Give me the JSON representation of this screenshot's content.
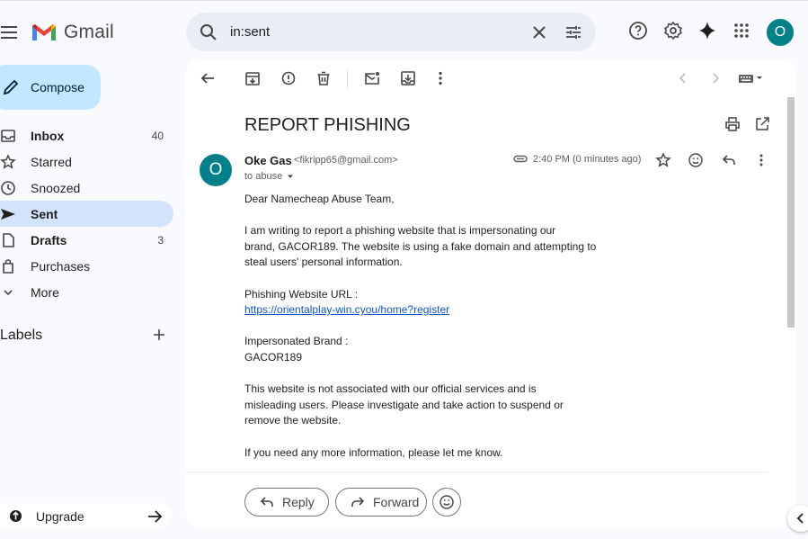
{
  "app": {
    "logo_text": "Gmail",
    "account_initial": "O"
  },
  "search": {
    "value": "in:sent"
  },
  "sidebar": {
    "compose_label": "Compose",
    "items": [
      {
        "label": "Inbox",
        "count": "40",
        "icon": "inbox-icon"
      },
      {
        "label": "Starred",
        "count": "",
        "icon": "star-icon"
      },
      {
        "label": "Snoozed",
        "count": "",
        "icon": "clock-icon"
      },
      {
        "label": "Sent",
        "count": "",
        "icon": "send-icon"
      },
      {
        "label": "Drafts",
        "count": "3",
        "icon": "draft-icon"
      },
      {
        "label": "Purchases",
        "count": "",
        "icon": "shopping-bag-icon"
      },
      {
        "label": "More",
        "count": "",
        "icon": "chevron-down-icon"
      }
    ],
    "labels_title": "Labels",
    "upgrade_label": "Upgrade"
  },
  "email": {
    "subject": "REPORT PHISHING",
    "sender_initial": "O",
    "sender_name": "Oke Gas",
    "sender_email": "<fikripp65@gmail.com>",
    "to": "to abuse",
    "time": "2:40 PM (0 minutes ago)",
    "body": {
      "greeting": "Dear Namecheap Abuse Team,",
      "p1_l1": "I am writing to report a phishing website that is impersonating our",
      "p1_l2": "brand, GACOR189. The website is using a fake domain and attempting to",
      "p1_l3": "steal users' personal information.",
      "url_label": "Phishing Website URL :",
      "url": "https://orientalplay-win.cyou/home?register",
      "brand_label": "Impersonated Brand :",
      "brand": "GACOR189",
      "p3_l1": "This website is not associated with our official services and is",
      "p3_l2": "misleading users. Please investigate and take action to suspend or",
      "p3_l3": "remove the website.",
      "p4": "If you need any more information, please let me know."
    },
    "reply_label": "Reply",
    "forward_label": "Forward"
  },
  "colors": {
    "accent": "#c2e7ff",
    "active_nav": "#d3e3fd",
    "avatar": "#00818a",
    "link": "#1155cc"
  }
}
